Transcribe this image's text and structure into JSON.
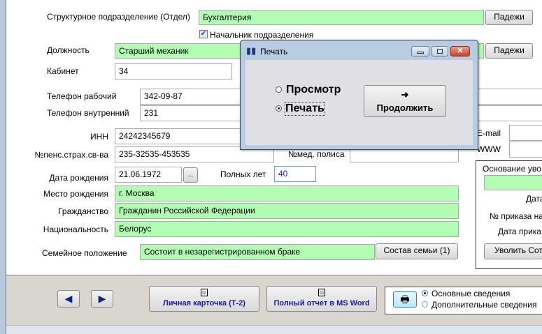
{
  "form": {
    "department_label": "Структурное подразделение (Отдел)",
    "department": "Бухгалтерия",
    "cases_button": "Падежи",
    "head_checkbox_label": "Начальник подразделения",
    "head_checked": true,
    "position_label": "Должность",
    "position": "Старший механик",
    "office_label": "Кабинет",
    "office": "34",
    "phone_work_label": "Телефон рабочий",
    "phone_work": "342-09-87",
    "phone_int_label": "Телефон внутренний",
    "phone_int": "231",
    "inn_label": "ИНН",
    "inn": "24242345679",
    "pension_label": "№пенс.страх.св-ва",
    "pension": "235-32535-453535",
    "med_label": "№мед. полиса",
    "med": "",
    "email_label": "E-mail",
    "www_label": "WWW",
    "birth_label": "Дата рождения",
    "birth": "21.06.1972",
    "date_button": "...",
    "age_label": "Полных лет",
    "age": "40",
    "birthplace_label": "Место рождения",
    "birthplace": "г. Москва",
    "citizenship_label": "Гражданство",
    "citizenship": "Гражданин Российской Федерации",
    "nationality_label": "Национальность",
    "nationality": "Белорус",
    "marital_label": "Семейное положение",
    "marital": "Состоит в незарегистрированном браке",
    "family_button": "Состав семьи (1)"
  },
  "dismissal": {
    "reason_label": "Основание уво",
    "date_label": "Дата",
    "order_no_label": "№ приказа на",
    "order_date_label": "Дата прика",
    "dismiss_button": "Уволить Сотр"
  },
  "dialog": {
    "title": "Печать",
    "option_preview": "Просмотр",
    "option_print": "Печать",
    "selected": "print",
    "continue_button": "Продолжить",
    "arrow": "➜"
  },
  "bottom": {
    "card_button": "Личная карточка (Т-2)",
    "word_button": "Полный отчет в MS Word",
    "option_main": "Основные сведения",
    "option_extra": "Дополнительные сведения"
  }
}
